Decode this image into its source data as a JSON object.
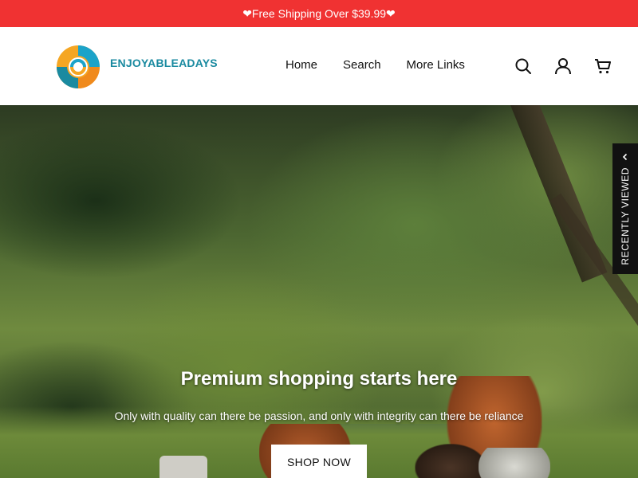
{
  "announcement": {
    "text": "❤Free Shipping Over $39.99❤"
  },
  "header": {
    "brand": "ENJOYABLEADAYS",
    "nav": [
      {
        "label": "Home"
      },
      {
        "label": "Search"
      },
      {
        "label": "More Links"
      }
    ],
    "icons": [
      "search-icon",
      "account-icon",
      "cart-icon"
    ]
  },
  "hero": {
    "title": "Premium shopping starts here",
    "subtitle": "Only with quality can there be passion, and only with integrity can there be reliance",
    "button_label": "SHOP NOW"
  },
  "recently_viewed": {
    "label": "RECENTLY VIEWED"
  },
  "colors": {
    "announcement_bg": "#f03232",
    "brand_text": "#1a8aa0",
    "logo_orange": "#f5a623",
    "logo_blue": "#1ca3c9",
    "logo_teal": "#1a8aa0",
    "sidebar_tab_bg": "#111111"
  }
}
